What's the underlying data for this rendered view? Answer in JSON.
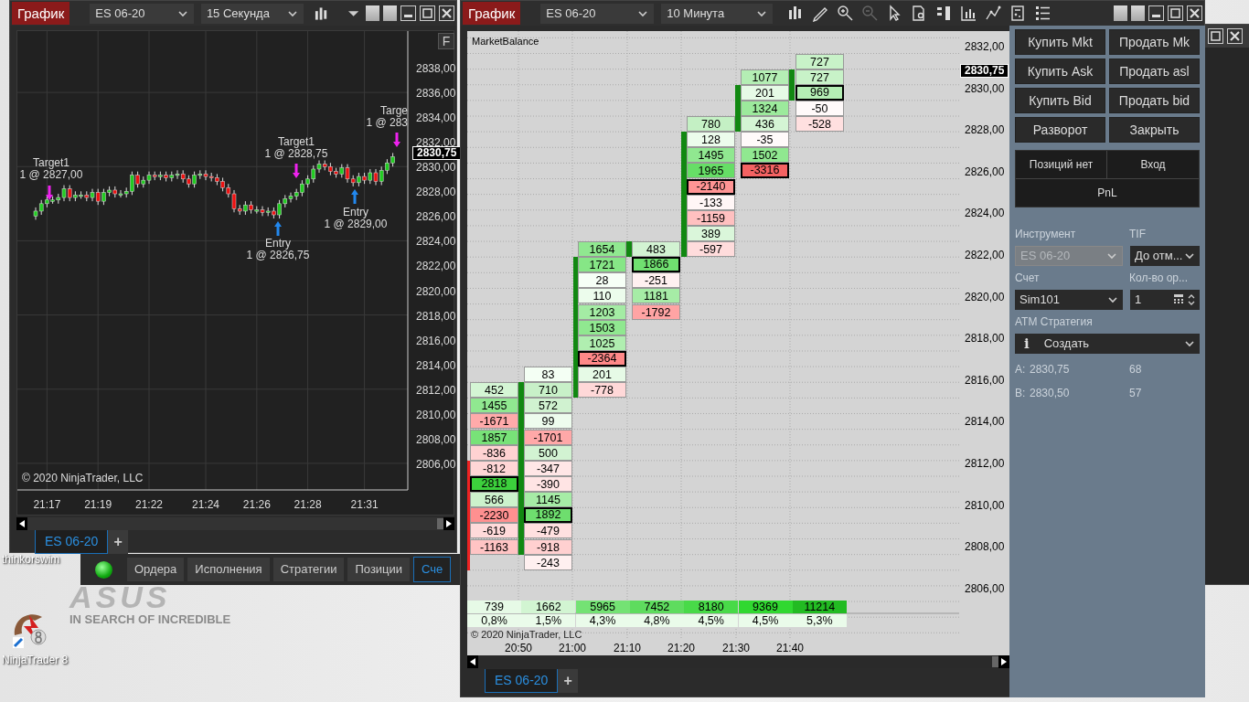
{
  "desktop": {
    "icons": [
      {
        "label": "thinkorswim"
      },
      {
        "label": "NinjaTrader 8"
      }
    ],
    "wallpaper": {
      "logo": "ASUS",
      "tagline": "IN SEARCH OF INCREDIBLE"
    }
  },
  "control_center": {
    "connected": true,
    "tabs": [
      {
        "label": "Ордера",
        "selected": false
      },
      {
        "label": "Исполнения",
        "selected": false
      },
      {
        "label": "Стратегии",
        "selected": false
      },
      {
        "label": "Позиции",
        "selected": false
      },
      {
        "label": "Сче",
        "selected": true
      }
    ]
  },
  "left_chart": {
    "title_button": "График",
    "instrument": "ES 06-20",
    "interval": "15 Секунда",
    "f_button": "F",
    "current_price": "2830,75",
    "copyright": "© 2020 NinjaTrader, LLC",
    "chart_data": {
      "type": "candlestick",
      "grid": true,
      "ylim": [
        2803.85,
        2840.96
      ],
      "yticks": [
        {
          "value": 2838,
          "label": "2838,00"
        },
        {
          "value": 2836,
          "label": "2836,00"
        },
        {
          "value": 2834,
          "label": "2834,00"
        },
        {
          "value": 2832,
          "label": "2832,00"
        },
        {
          "value": 2830,
          "label": "2830,00"
        },
        {
          "value": 2828,
          "label": "2828,00"
        },
        {
          "value": 2826,
          "label": "2826,00"
        },
        {
          "value": 2824,
          "label": "2824,00"
        },
        {
          "value": 2822,
          "label": "2822,00"
        },
        {
          "value": 2820,
          "label": "2820,00"
        },
        {
          "value": 2818,
          "label": "2818,00"
        },
        {
          "value": 2816,
          "label": "2816,00"
        },
        {
          "value": 2814,
          "label": "2814,00"
        },
        {
          "value": 2812,
          "label": "2812,00"
        },
        {
          "value": 2810,
          "label": "2810,00"
        },
        {
          "value": 2808,
          "label": "2808,00"
        },
        {
          "value": 2806,
          "label": "2806,00"
        }
      ],
      "categories": [
        null,
        null,
        "21:17",
        null,
        null,
        null,
        null,
        null,
        null,
        null,
        null,
        "21:19",
        null,
        null,
        null,
        null,
        null,
        null,
        null,
        null,
        "21:22",
        null,
        null,
        null,
        null,
        null,
        null,
        null,
        null,
        null,
        "21:24",
        null,
        null,
        null,
        null,
        null,
        null,
        null,
        null,
        "21:26",
        null,
        null,
        null,
        null,
        null,
        null,
        null,
        null,
        "21:28",
        null,
        null,
        null,
        null,
        null,
        null,
        null,
        null,
        null,
        "21:31",
        null,
        null,
        null,
        null,
        null
      ],
      "ohlc": [
        [
          2826.0,
          2826.7,
          2825.7,
          2826.4
        ],
        [
          2826.4,
          2827.3,
          2826.1,
          2827.0
        ],
        [
          2827.0,
          2827.6,
          2826.7,
          2827.3
        ],
        [
          2827.3,
          2827.6,
          2827.0,
          2827.3
        ],
        [
          2827.3,
          2827.8,
          2827.0,
          2827.5
        ],
        [
          2827.5,
          2828.5,
          2827.2,
          2828.2
        ],
        [
          2828.2,
          2828.5,
          2827.2,
          2827.5
        ],
        [
          2827.5,
          2828.0,
          2827.2,
          2827.7
        ],
        [
          2827.7,
          2828.0,
          2827.4,
          2827.7
        ],
        [
          2827.7,
          2828.0,
          2827.2,
          2827.5
        ],
        [
          2827.5,
          2828.2,
          2827.2,
          2827.9
        ],
        [
          2827.9,
          2828.2,
          2826.9,
          2827.2
        ],
        [
          2827.2,
          2828.2,
          2826.9,
          2827.9
        ],
        [
          2827.9,
          2828.4,
          2827.6,
          2828.1
        ],
        [
          2828.1,
          2828.4,
          2827.5,
          2827.8
        ],
        [
          2827.8,
          2828.1,
          2827.5,
          2827.8
        ],
        [
          2827.8,
          2828.3,
          2827.5,
          2828.0
        ],
        [
          2828.0,
          2829.6,
          2827.7,
          2829.3
        ],
        [
          2829.3,
          2829.6,
          2828.3,
          2828.6
        ],
        [
          2828.6,
          2829.2,
          2828.3,
          2828.9
        ],
        [
          2828.9,
          2829.6,
          2828.6,
          2829.3
        ],
        [
          2829.3,
          2829.6,
          2828.9,
          2829.2
        ],
        [
          2829.2,
          2829.6,
          2828.9,
          2829.3
        ],
        [
          2829.3,
          2829.6,
          2828.8,
          2829.1
        ],
        [
          2829.1,
          2829.6,
          2828.8,
          2829.3
        ],
        [
          2829.3,
          2829.7,
          2829.0,
          2829.4
        ],
        [
          2829.4,
          2829.7,
          2828.7,
          2829.0
        ],
        [
          2829.0,
          2829.3,
          2828.3,
          2828.6
        ],
        [
          2828.6,
          2829.6,
          2828.3,
          2829.3
        ],
        [
          2829.3,
          2829.7,
          2829.0,
          2829.4
        ],
        [
          2829.4,
          2829.7,
          2828.9,
          2829.2
        ],
        [
          2829.2,
          2829.5,
          2828.8,
          2829.1
        ],
        [
          2829.1,
          2829.4,
          2828.5,
          2828.8
        ],
        [
          2828.8,
          2829.1,
          2828.0,
          2828.3
        ],
        [
          2828.3,
          2828.6,
          2827.5,
          2827.8
        ],
        [
          2827.8,
          2828.1,
          2826.3,
          2826.6
        ],
        [
          2826.6,
          2826.9,
          2826.1,
          2826.4
        ],
        [
          2826.4,
          2827.2,
          2826.1,
          2826.9
        ],
        [
          2826.9,
          2827.2,
          2826.2,
          2826.5
        ],
        [
          2826.5,
          2826.8,
          2826.2,
          2826.5
        ],
        [
          2826.5,
          2826.8,
          2826.0,
          2826.3
        ],
        [
          2826.3,
          2826.7,
          2826.0,
          2826.4
        ],
        [
          2826.4,
          2826.7,
          2825.8,
          2826.1
        ],
        [
          2826.1,
          2827.3,
          2825.8,
          2827.0
        ],
        [
          2827.0,
          2827.7,
          2826.7,
          2827.4
        ],
        [
          2827.4,
          2827.9,
          2827.1,
          2827.6
        ],
        [
          2827.6,
          2828.2,
          2827.3,
          2827.9
        ],
        [
          2827.9,
          2828.9,
          2827.6,
          2828.6
        ],
        [
          2828.6,
          2829.3,
          2828.3,
          2829.0
        ],
        [
          2829.0,
          2830.1,
          2828.7,
          2829.8
        ],
        [
          2829.8,
          2830.5,
          2829.5,
          2830.2
        ],
        [
          2830.2,
          2830.5,
          2829.7,
          2830.0
        ],
        [
          2830.0,
          2830.3,
          2829.3,
          2829.6
        ],
        [
          2829.6,
          2829.9,
          2829.1,
          2829.4
        ],
        [
          2829.4,
          2830.2,
          2829.1,
          2829.9
        ],
        [
          2829.9,
          2830.2,
          2828.7,
          2829.0
        ],
        [
          2829.0,
          2829.3,
          2828.4,
          2828.7
        ],
        [
          2828.7,
          2829.5,
          2828.4,
          2829.2
        ],
        [
          2829.2,
          2829.5,
          2828.6,
          2828.9
        ],
        [
          2828.9,
          2829.8,
          2828.6,
          2829.5
        ],
        [
          2829.5,
          2829.8,
          2828.5,
          2828.8
        ],
        [
          2828.8,
          2830.0,
          2828.5,
          2829.7
        ],
        [
          2829.7,
          2830.6,
          2829.4,
          2830.3
        ],
        [
          2830.3,
          2831.1,
          2830.0,
          2830.8
        ]
      ]
    },
    "markers": [
      {
        "kind": "target",
        "lines": [
          "Targe",
          "1 @ 283"
        ]
      },
      {
        "kind": "target",
        "lines": [
          "Target1",
          "1 @ 2828,75"
        ]
      },
      {
        "kind": "target",
        "lines": [
          "Target1",
          "1 @ 2827,00"
        ]
      },
      {
        "kind": "entry",
        "lines": [
          "Entry",
          "1 @ 2829,00"
        ]
      },
      {
        "kind": "entry",
        "lines": [
          "Entry",
          "1 @ 2826,75"
        ]
      }
    ],
    "tabs": [
      {
        "label": "ES 06-20",
        "selected": true
      }
    ],
    "add_tab": "+"
  },
  "mid_chart": {
    "title_button": "График",
    "instrument": "ES 06-20",
    "interval": "10 Минута",
    "indicator": "MarketBalance",
    "price_labels": [
      "2832,00",
      "2830,00",
      "2828,00",
      "2826,00",
      "2824,00",
      "2822,00",
      "2820,00",
      "2818,00",
      "2816,00",
      "2814,00",
      "2812,00",
      "2810,00",
      "2808,00",
      "2806,00"
    ],
    "current_price": "2830,75",
    "columns": [
      {
        "cells": [
          {
            "value": "452",
            "color": "#d4f5d4",
            "outlined": false
          },
          {
            "value": "1455",
            "color": "#90e890",
            "outlined": false
          },
          {
            "value": "-1671",
            "color": "#ffaaaa",
            "outlined": false
          },
          {
            "value": "1857",
            "color": "#78e278",
            "outlined": false
          },
          {
            "value": "-836",
            "color": "#ffd2d2",
            "outlined": false
          },
          {
            "value": "-812",
            "color": "#ffd6d6",
            "outlined": false
          },
          {
            "value": "2818",
            "color": "#3cd03c",
            "outlined": true
          },
          {
            "value": "566",
            "color": "#ccf2cc",
            "outlined": false
          },
          {
            "value": "-2230",
            "color": "#ff9090",
            "outlined": false
          },
          {
            "value": "-619",
            "color": "#ffdada",
            "outlined": false
          },
          {
            "value": "-1163",
            "color": "#ffc4c4",
            "outlined": false
          }
        ]
      },
      {
        "cells": [
          {
            "value": "83",
            "color": "#f4fff4",
            "outlined": false
          },
          {
            "value": "710",
            "color": "#c8f0c8",
            "outlined": false
          },
          {
            "value": "572",
            "color": "#d0f2d0",
            "outlined": false
          },
          {
            "value": "99",
            "color": "#eefcee",
            "outlined": false
          },
          {
            "value": "-1701",
            "color": "#ffa8a8",
            "outlined": false
          },
          {
            "value": "500",
            "color": "#d2f3d2",
            "outlined": false
          },
          {
            "value": "-347",
            "color": "#ffe6e6",
            "outlined": false
          },
          {
            "value": "-390",
            "color": "#ffe4e4",
            "outlined": false
          },
          {
            "value": "1145",
            "color": "#a6eca6",
            "outlined": false
          },
          {
            "value": "1892",
            "color": "#6ede6e",
            "outlined": true
          },
          {
            "value": "-479",
            "color": "#ffe0e0",
            "outlined": false
          },
          {
            "value": "-918",
            "color": "#ffd0d0",
            "outlined": false
          },
          {
            "value": "-243",
            "color": "#fff0f0",
            "outlined": false
          }
        ]
      },
      {
        "cells": [
          {
            "value": "1654",
            "color": "#90e890",
            "outlined": false
          },
          {
            "value": "1721",
            "color": "#86e686",
            "outlined": false
          },
          {
            "value": "28",
            "color": "#f6fff6",
            "outlined": false
          },
          {
            "value": "110",
            "color": "#ecfcec",
            "outlined": false
          },
          {
            "value": "1203",
            "color": "#a4eca4",
            "outlined": false
          },
          {
            "value": "1503",
            "color": "#90e890",
            "outlined": false
          },
          {
            "value": "1025",
            "color": "#b0eeb0",
            "outlined": false
          },
          {
            "value": "-2364",
            "color": "#ff8888",
            "outlined": true
          },
          {
            "value": "201",
            "color": "#e6fae6",
            "outlined": false
          },
          {
            "value": "-778",
            "color": "#ffd8d8",
            "outlined": false
          }
        ]
      },
      {
        "cells": [
          {
            "value": "483",
            "color": "#d2f3d2",
            "outlined": false
          },
          {
            "value": "1866",
            "color": "#70e070",
            "outlined": true
          },
          {
            "value": "-251",
            "color": "#fff0f0",
            "outlined": false
          },
          {
            "value": "1181",
            "color": "#a6eca6",
            "outlined": false
          },
          {
            "value": "-1792",
            "color": "#ffa4a4",
            "outlined": false
          }
        ]
      },
      {
        "cells": [
          {
            "value": "780",
            "color": "#c4f0c4",
            "outlined": false
          },
          {
            "value": "128",
            "color": "#ecfcec",
            "outlined": false
          },
          {
            "value": "1495",
            "color": "#90e890",
            "outlined": false
          },
          {
            "value": "1965",
            "color": "#66de66",
            "outlined": false
          },
          {
            "value": "-2140",
            "color": "#ff9494",
            "outlined": true
          },
          {
            "value": "-133",
            "color": "#fff6f6",
            "outlined": false
          },
          {
            "value": "-1159",
            "color": "#ffc0c0",
            "outlined": false
          },
          {
            "value": "389",
            "color": "#daf6da",
            "outlined": false
          },
          {
            "value": "-597",
            "color": "#ffdcdc",
            "outlined": false
          }
        ]
      },
      {
        "cells": [
          {
            "value": "1077",
            "color": "#b4eeb4",
            "outlined": false
          },
          {
            "value": "201",
            "color": "#e6fae6",
            "outlined": false
          },
          {
            "value": "1324",
            "color": "#9cea9c",
            "outlined": false
          },
          {
            "value": "436",
            "color": "#d4f5d4",
            "outlined": false
          },
          {
            "value": "-35",
            "color": "#fffafa",
            "outlined": false
          },
          {
            "value": "1502",
            "color": "#90e890",
            "outlined": false
          },
          {
            "value": "-3316",
            "color": "#f46262",
            "outlined": true
          }
        ]
      },
      {
        "cells": [
          {
            "value": "727",
            "color": "#c8f2c8",
            "outlined": false
          },
          {
            "value": "727",
            "color": "#c8f2c8",
            "outlined": false
          },
          {
            "value": "969",
            "color": "#b4eeb4",
            "outlined": true
          },
          {
            "value": "-50",
            "color": "#fffafa",
            "outlined": false
          },
          {
            "value": "-528",
            "color": "#ffe0e0",
            "outlined": false
          }
        ]
      }
    ],
    "totals": [
      {
        "value": "739",
        "percent": "0,8%",
        "color": "#e6fae6"
      },
      {
        "value": "1662",
        "percent": "1,5%",
        "color": "#d2f5d2"
      },
      {
        "value": "5965",
        "percent": "4,3%",
        "color": "#74e274"
      },
      {
        "value": "7452",
        "percent": "4,8%",
        "color": "#5edc5e"
      },
      {
        "value": "8180",
        "percent": "4,5%",
        "color": "#48da48"
      },
      {
        "value": "9369",
        "percent": "4,5%",
        "color": "#30d830"
      },
      {
        "value": "11214",
        "percent": "5,3%",
        "color": "#22bb22"
      }
    ],
    "copyright": "© 2020 NinjaTrader, LLC",
    "time_labels": [
      "20:50",
      "21:00",
      "21:10",
      "21:20",
      "21:30",
      "21:40"
    ],
    "tabs": [
      {
        "label": "ES 06-20",
        "selected": true
      }
    ],
    "add_tab": "+"
  },
  "order_panel": {
    "buttons": [
      "Купить Mkt",
      "Продать Mk",
      "Купить Ask",
      "Продать asl",
      "Купить Bid",
      "Продать bid",
      "Разворот",
      "Закрыть"
    ],
    "position": "Позиций нет",
    "entry": "Вход",
    "pnl": "PnL",
    "instrument_label": "Инструмент",
    "instrument": {
      "value": "ES 06-20",
      "disabled": true
    },
    "tif_label": "TIF",
    "tif": "До отм...",
    "account_label": "Счет",
    "account": "Sim101",
    "quantity_label": "Кол-во ор...",
    "quantity": "1",
    "atm_label": "ATM Стратегия",
    "atm_info": "i",
    "atm": "Создать",
    "quotes": [
      {
        "side": "A:",
        "price": "2830,75",
        "size": "68"
      },
      {
        "side": "B:",
        "price": "2830,50",
        "size": "57"
      }
    ]
  }
}
